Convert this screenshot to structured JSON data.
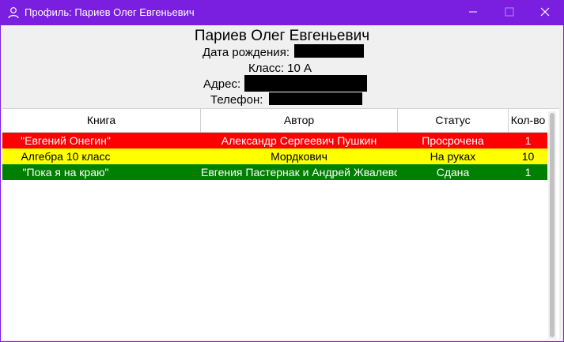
{
  "window": {
    "title": "Профиль: Париев Олег Евгеньевич",
    "accent_color": "#7a1fe0",
    "icons": [
      "user-icon",
      "minimize-icon",
      "maximize-icon",
      "close-icon"
    ]
  },
  "profile": {
    "name": "Париев Олег Евгеньевич",
    "birth_label": "Дата рождения:",
    "class_label": "Класс: 10 А",
    "address_label": "Адрес:",
    "phone_label": "Телефон:"
  },
  "table": {
    "headers": [
      "Книга",
      "Автор",
      "Статус",
      "Кол-во"
    ],
    "rows": [
      {
        "book": "\"Евгений Онегин\"",
        "author": "Александр Сергеевич Пушкин",
        "status": "Просрочена",
        "count": "1",
        "bg": "#ff0000",
        "fg": "#ffffff"
      },
      {
        "book": "Алгебра 10 класс",
        "author": "Мордкович",
        "status": "На руках",
        "count": "10",
        "bg": "#ffff00",
        "fg": "#000000"
      },
      {
        "book": "\"Пока я на краю\"",
        "author": "Евгения Пастернак и Андрей Жвалевский",
        "status": "Сдана",
        "count": "1",
        "bg": "#008000",
        "fg": "#ffffff"
      }
    ]
  }
}
